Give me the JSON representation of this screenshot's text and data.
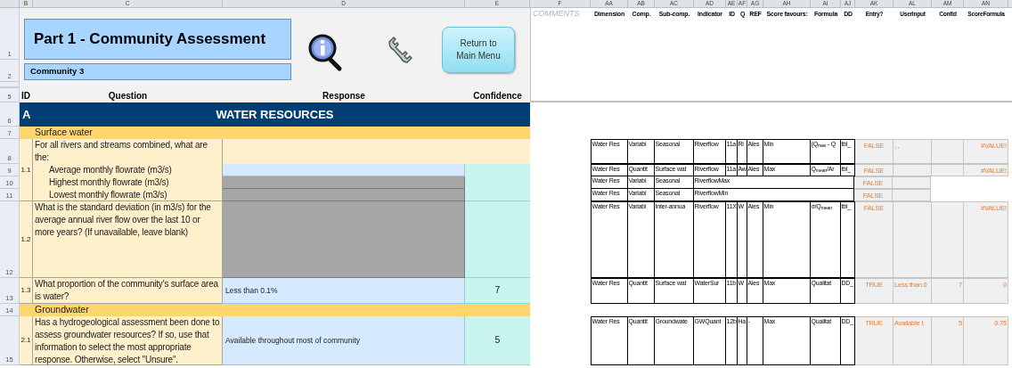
{
  "column_letters": [
    "B",
    "C",
    "D",
    "E",
    "F",
    "AA",
    "AB",
    "AC",
    "AD",
    "AE",
    "AF",
    "AG",
    "AH",
    "AI",
    "AJ",
    "AK",
    "AL",
    "AM",
    "AN"
  ],
  "title": "Part 1 - Community Assessment",
  "community": "Community 3",
  "button": "Return to Main Menu",
  "header_rows": [
    "1",
    "2",
    "5"
  ],
  "table_header": {
    "id": "ID",
    "question": "Question",
    "response": "Response",
    "confidence": "Confidence"
  },
  "comments_label": "COMMENTS",
  "calc_headers": [
    "Dimension",
    "Comp.",
    "Sub-comp.",
    "Indicator",
    "ID",
    "Q",
    "REF",
    "Score favours:",
    "Formula",
    "DD",
    "Entry?",
    "UserInput",
    "Confid",
    "ScoreFormula"
  ],
  "sections": [
    {
      "row": "6",
      "id": "A",
      "title": "WATER RESOURCES",
      "subsections": [
        {
          "row": "7",
          "title": "Surface water",
          "questions": [
            {
              "row": "8",
              "id": "1.1",
              "text": "For all rivers and streams combined, what are the:",
              "calc": {
                "kind": "full",
                "dimension": "Water Res",
                "comp": "Variabi",
                "sub_comp": "Seasonal",
                "indicator": "Riverflow",
                "id": "11a",
                "q": "Ri",
                "ref": "Ales",
                "score_favours": "Min",
                "formula": "(Q$_{max}$ - Q",
                "dd": "tbl_",
                "entry": "FALSE",
                "user_input": ", ,",
                "score": "#VALUE!"
              },
              "items": [
                {
                  "row": "9",
                  "text": "Average monthly flowrate (m3/s)",
                  "disabled": false,
                  "calc": {
                    "kind": "full",
                    "dimension": "Water Res",
                    "comp": "Quantit",
                    "sub_comp": "Surface wat",
                    "indicator": "Riverflow",
                    "id": "11a",
                    "q": "Aw",
                    "ref": "Ales",
                    "score_favours": "Max",
                    "formula": "Q$_{mean}$/Ar",
                    "dd": "tbl_",
                    "entry": "FALSE",
                    "score": "#VALUE!"
                  }
                },
                {
                  "row": "10",
                  "text": "Highest monthly flowrate (m3/s)",
                  "disabled": true,
                  "calc": {
                    "kind": "short",
                    "dimension": "Water Res",
                    "comp": "Variabi",
                    "sub_comp": "Seasonal",
                    "indicator": "RiverflowMax",
                    "entry": "FALSE"
                  }
                },
                {
                  "row": "11",
                  "text": "Lowest monthly flowrate (m3/s)",
                  "disabled": true,
                  "calc": {
                    "kind": "short",
                    "dimension": "Water Res",
                    "comp": "Variabi",
                    "sub_comp": "Seasonal",
                    "indicator": "RiverflowMin",
                    "entry": "FALSE"
                  }
                }
              ]
            },
            {
              "row": "12",
              "id": "1.2",
              "text": "What is the standard deviation (in m3/s) for the average annual river flow over the last 10 or more years? (If unavailable, leave blank)",
              "disabled": true,
              "calc": {
                "kind": "full",
                "dimension": "Water Res",
                "comp": "Variabi",
                "sub_comp": "Inter-annua",
                "indicator": "Riverflow",
                "id": "11X",
                "q": "W",
                "ref": "Ales",
                "score_favours": "Min",
                "formula": "σ/Q$_{mean}$",
                "dd": "tbl_",
                "entry": "FALSE",
                "score": "#VALUE!"
              }
            },
            {
              "row": "13",
              "id": "1.3",
              "text": "What proportion of the community's surface area is water?",
              "disabled": false,
              "response": "Less than 0.1%",
              "confidence": "7",
              "calc": {
                "kind": "full",
                "dimension": "Water Res",
                "comp": "Quantit",
                "sub_comp": "Surface wat",
                "indicator": "WaterSur",
                "id": "11b",
                "q": "W",
                "ref": "Ales",
                "score_favours": "Max",
                "formula": "Qualitat",
                "dd": "DD_",
                "entry": "TRUE",
                "user_input": "Less than 0",
                "confid": "7",
                "score": "0"
              }
            }
          ]
        },
        {
          "row": "14",
          "title": "Groundwater",
          "questions": [
            {
              "row": "15",
              "id": "2.1",
              "text": "Has a hydrogeological assessment been done to assess groundwater resources? If so, use that information to select the most appropriate response. Otherwise, select \"Unsure\".",
              "disabled": false,
              "response": "Available throughout most of community",
              "confidence": "5",
              "calc": {
                "kind": "full",
                "dimension": "Water Res",
                "comp": "Quantit",
                "sub_comp": "Groundwate",
                "indicator": "GWQuant",
                "id": "12b",
                "q": "Ha",
                "ref": "-",
                "score_favours": "Max",
                "formula": "Qualitat",
                "dd": "DD_",
                "entry": "TRUE",
                "user_input": "Available t",
                "confid": "5",
                "score": "0.75"
              }
            }
          ]
        }
      ]
    }
  ]
}
